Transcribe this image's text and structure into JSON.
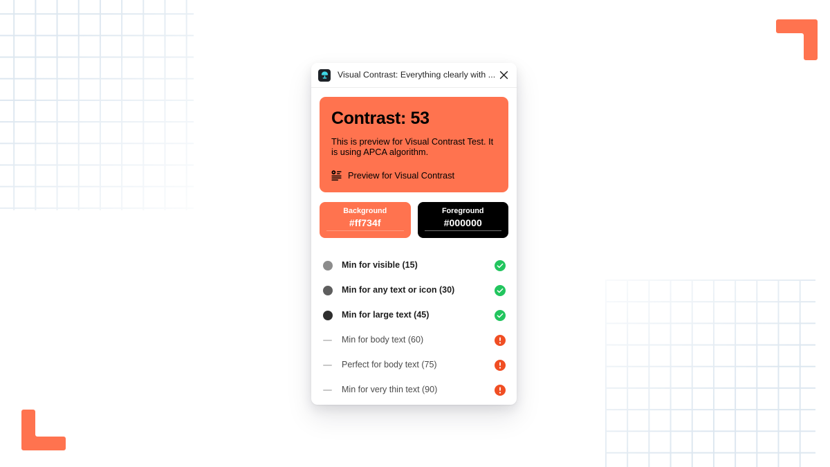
{
  "window": {
    "title": "Visual Contrast: Everything clearly with ...",
    "icon": "visual-contrast-logo-icon",
    "close_icon": "close-icon"
  },
  "preview": {
    "heading": "Contrast: 53",
    "description": "This is preview for Visual Contrast Test. It is using APCA algorithm.",
    "link_label": "Preview for Visual Contrast",
    "link_icon": "text-contrast-icon",
    "background_color": "#ff734f",
    "text_color": "#000000"
  },
  "swatches": [
    {
      "label": "Background",
      "value": "#ff734f",
      "swatch_color": "#ff734f",
      "text_color": "#ffffff"
    },
    {
      "label": "Foreground",
      "value": "#000000",
      "swatch_color": "#000000",
      "text_color": "#ffffff"
    }
  ],
  "criteria": [
    {
      "label": "Min for visible (15)",
      "threshold": 15,
      "state": "pass",
      "marker": "dot",
      "marker_color": "#8c8c8c",
      "status_icon": "check-circle-icon",
      "status_color": "#22c55e"
    },
    {
      "label": "Min for any text or icon (30)",
      "threshold": 30,
      "state": "pass",
      "marker": "dot",
      "marker_color": "#5e5e5e",
      "status_icon": "check-circle-icon",
      "status_color": "#22c55e"
    },
    {
      "label": "Min for large text (45)",
      "threshold": 45,
      "state": "pass",
      "marker": "dot",
      "marker_color": "#2e2e2e",
      "status_icon": "check-circle-icon",
      "status_color": "#22c55e"
    },
    {
      "label": "Min for body text (60)",
      "threshold": 60,
      "state": "fail",
      "marker": "dash",
      "marker_color": "#c8c8c8",
      "status_icon": "alert-circle-icon",
      "status_color": "#f04e23"
    },
    {
      "label": "Perfect for body text (75)",
      "threshold": 75,
      "state": "fail",
      "marker": "dash",
      "marker_color": "#c8c8c8",
      "status_icon": "alert-circle-icon",
      "status_color": "#f04e23"
    },
    {
      "label": "Min for very thin text (90)",
      "threshold": 90,
      "state": "fail",
      "marker": "dash",
      "marker_color": "#c8c8c8",
      "status_icon": "alert-circle-icon",
      "status_color": "#f04e23"
    }
  ],
  "background": {
    "grid_color": "#dde7f0",
    "accent_color": "#ff734f",
    "page_color": "#ffffff"
  }
}
